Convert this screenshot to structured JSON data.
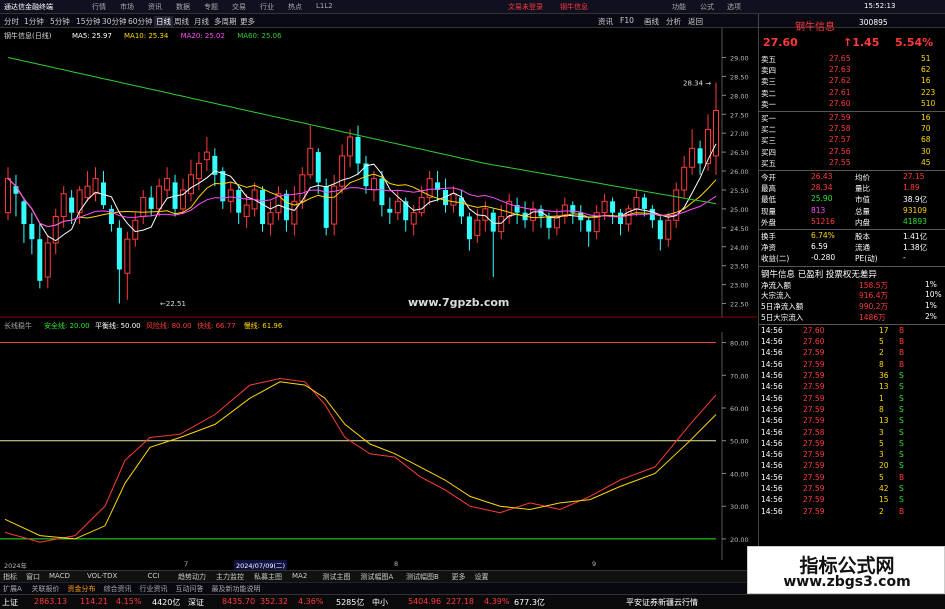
{
  "titlebar": {
    "app": "通达信金融终端",
    "menus": [
      "行情",
      "市场",
      "资讯",
      "数据",
      "专题",
      "交易",
      "行业",
      "热点",
      "L1L2"
    ],
    "center": [
      "文易未登录",
      "钢牛信息"
    ],
    "right": [
      "功能",
      "公式",
      "选项",
      "15:52:13"
    ]
  },
  "toolbar": {
    "periods": [
      "分时",
      "1分钟",
      "5分钟",
      "15分钟",
      "30分钟",
      "60分钟",
      "日线",
      "周线",
      "月线",
      "多周期",
      "更多"
    ],
    "active": "日线",
    "right": [
      "资讯",
      "F10",
      "画线",
      "分析",
      "返回"
    ]
  },
  "chart": {
    "name": "钢牛信息(日线)",
    "ma": [
      {
        "label": "MA5: 25.97",
        "color": "#ffffff"
      },
      {
        "label": "MA10: 25.34",
        "color": "#ffd700"
      },
      {
        "label": "MA20: 25.02",
        "color": "#ff4dff"
      },
      {
        "label": "MA60: 25.06",
        "color": "#33cc33"
      }
    ],
    "high_label": "28.34",
    "low_label": "22.51",
    "site": "www.7gpzb.com",
    "yticks": [
      "28.00",
      "26.50",
      "26.00",
      "27.50",
      "27.00",
      "26.50",
      "26.00",
      "25.50",
      "25.00",
      "24.50",
      "24.00",
      "23.50",
      "23.00",
      "22.50"
    ]
  },
  "indicator": {
    "name": "长线稳牛",
    "items": [
      {
        "t": "安全线: 20.00",
        "c": "#2ee52e"
      },
      {
        "t": "平衡线: 50.00",
        "c": "#ffffff"
      },
      {
        "t": "风险线: 80.00",
        "c": "#ff3b3b"
      },
      {
        "t": "快线: 66.77",
        "c": "#ff3b3b"
      },
      {
        "t": "慢线: 61.96",
        "c": "#ffd700"
      }
    ],
    "yticks": [
      "80.00",
      "70.00",
      "60.00",
      "50.00",
      "40.00",
      "30.00",
      "20.00"
    ]
  },
  "xaxis": {
    "labels": [
      "2024年",
      "7",
      "2024/07/09(二)",
      "8",
      "9"
    ]
  },
  "bottom_tabs": [
    "指标",
    "窗口",
    "MACD",
    "VOL-TDX",
    "CCI",
    "趋势动力",
    "主力监控",
    "私募主图",
    "MA2",
    "测试主图",
    "测试幅图A",
    "测试幅图B",
    "更多",
    "设置"
  ],
  "bottom_tabs2": [
    "扩展A",
    "关联报价",
    "资金分布",
    "综合资讯",
    "行业资讯",
    "互动问答",
    "最及新功能说明"
  ],
  "quote": {
    "name": "钢牛信息",
    "code": "300895",
    "price": "27.60",
    "change": "↑1.45",
    "pct": "5.54%",
    "sells": [
      {
        "l": "卖五",
        "p": "27.65",
        "v": "51"
      },
      {
        "l": "卖四",
        "p": "27.63",
        "v": "62"
      },
      {
        "l": "卖三",
        "p": "27.62",
        "v": "16"
      },
      {
        "l": "卖二",
        "p": "27.61",
        "v": "223"
      },
      {
        "l": "卖一",
        "p": "27.60",
        "v": "510"
      }
    ],
    "buys": [
      {
        "l": "买一",
        "p": "27.59",
        "v": "16"
      },
      {
        "l": "买二",
        "p": "27.58",
        "v": "70"
      },
      {
        "l": "买三",
        "p": "27.57",
        "v": "68"
      },
      {
        "l": "买四",
        "p": "27.56",
        "v": "30"
      },
      {
        "l": "买五",
        "p": "27.55",
        "v": "45"
      }
    ],
    "stats": [
      {
        "a": "今开",
        "b": "26.43",
        "bc": "red",
        "c": "均价",
        "d": "27.15",
        "dc": "red"
      },
      {
        "a": "最高",
        "b": "28.34",
        "bc": "red",
        "c": "量比",
        "d": "1.89",
        "dc": "red"
      },
      {
        "a": "最低",
        "b": "25.90",
        "bc": "grn",
        "c": "市值",
        "d": "38.9亿",
        "dc": "wht"
      },
      {
        "a": "现量",
        "b": "813",
        "bc": "mag",
        "c": "总量",
        "d": "93109",
        "dc": "yel"
      },
      {
        "a": "外盘",
        "b": "51216",
        "bc": "red",
        "c": "内盘",
        "d": "41893",
        "dc": "grn"
      }
    ],
    "stats2": [
      {
        "a": "换手",
        "b": "6.74%",
        "bc": "yel",
        "c": "股本",
        "d": "1.41亿",
        "dc": "wht"
      },
      {
        "a": "净资",
        "b": "6.59",
        "bc": "wht",
        "c": "流通",
        "d": "1.38亿",
        "dc": "wht"
      },
      {
        "a": "收益(二)",
        "b": "-0.280",
        "bc": "wht",
        "c": "PE(动)",
        "d": "-",
        "dc": "wht"
      }
    ],
    "info": "钢牛信息 已盈利 投票权无差异",
    "flows": [
      {
        "a": "净流入额",
        "b": "158.5万",
        "c": "1%"
      },
      {
        "a": "大宗流入",
        "b": "916.4万",
        "c": "10%"
      },
      {
        "a": "5日净流入额",
        "b": "990.2万",
        "c": "1%"
      },
      {
        "a": "5日大宗流入",
        "b": "1486万",
        "c": "2%"
      }
    ],
    "ticks": [
      [
        "14:56",
        "27.60",
        "17",
        "B"
      ],
      [
        "14:56",
        "27.60",
        "5",
        "B"
      ],
      [
        "14:56",
        "27.59",
        "2",
        "B"
      ],
      [
        "14:56",
        "27.59",
        "8",
        "B"
      ],
      [
        "14:56",
        "27.59",
        "36",
        "S"
      ],
      [
        "14:56",
        "27.59",
        "13",
        "S"
      ],
      [
        "14:56",
        "27.59",
        "1",
        "S"
      ],
      [
        "14:56",
        "27.59",
        "8",
        "S"
      ],
      [
        "14:56",
        "27.59",
        "13",
        "S"
      ],
      [
        "14:56",
        "27.58",
        "3",
        "S"
      ],
      [
        "14:56",
        "27.59",
        "5",
        "S"
      ],
      [
        "14:56",
        "27.59",
        "3",
        "S"
      ],
      [
        "14:56",
        "27.59",
        "20",
        "S"
      ],
      [
        "14:56",
        "27.59",
        "5",
        "B"
      ],
      [
        "14:56",
        "27.59",
        "42",
        "S"
      ],
      [
        "14:56",
        "27.59",
        "15",
        "S"
      ],
      [
        "14:56",
        "27.59",
        "2",
        "B"
      ]
    ]
  },
  "status": {
    "items": [
      {
        "t": "上证",
        "c": "wht"
      },
      {
        "t": "2863.13",
        "c": "red"
      },
      {
        "t": "114.21",
        "c": "red"
      },
      {
        "t": "4.15%",
        "c": "red"
      },
      {
        "t": "4420亿",
        "c": "wht"
      },
      {
        "t": "深证",
        "c": "wht"
      },
      {
        "t": "8435.70",
        "c": "red"
      },
      {
        "t": "352.32",
        "c": "red"
      },
      {
        "t": "4.36%",
        "c": "red"
      },
      {
        "t": "5285亿",
        "c": "wht"
      },
      {
        "t": "中小",
        "c": "wht"
      },
      {
        "t": "5404.96",
        "c": "red"
      },
      {
        "t": "227.18",
        "c": "red"
      },
      {
        "t": "4.39%",
        "c": "red"
      },
      {
        "t": "677.3亿",
        "c": "wht"
      },
      {
        "t": "平安证券新疆云行情",
        "c": "wht"
      }
    ]
  },
  "watermark": {
    "title": "指标公式网",
    "url": "www.zbgs3.com"
  }
}
